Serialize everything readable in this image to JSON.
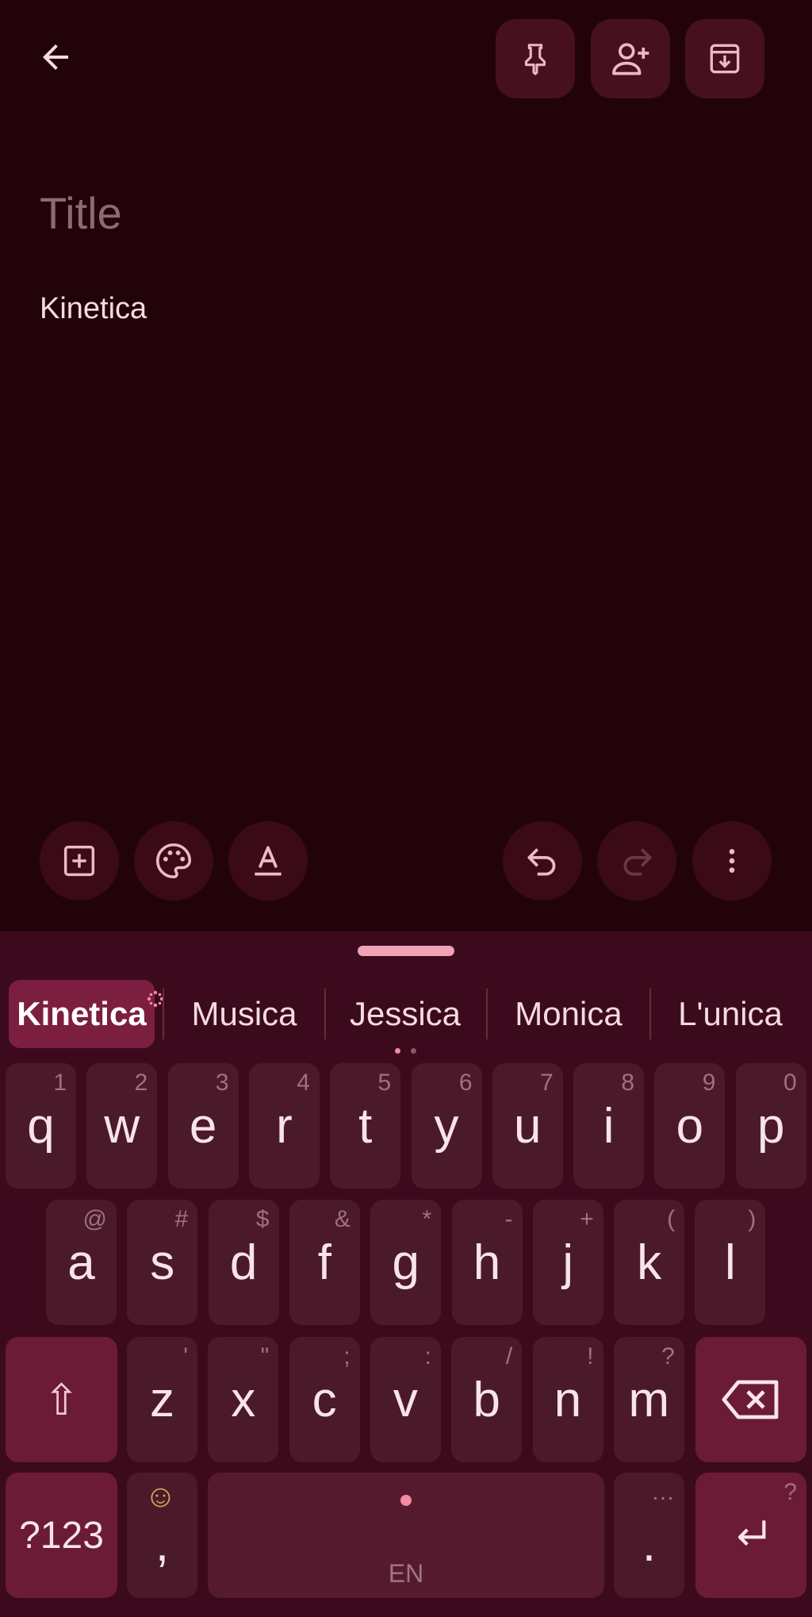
{
  "app": {
    "title_placeholder": "Title",
    "body_text": "Kinetica"
  },
  "top_bar": {
    "back": "arrow-left-icon",
    "pin": "pin-icon",
    "collaborator": "person-add-icon",
    "archive": "archive-icon"
  },
  "toolbar": {
    "add": "add-box-icon",
    "palette": "palette-icon",
    "text_format": "text-format-icon",
    "undo": "undo-icon",
    "redo": "redo-icon",
    "more": "more-vert-icon"
  },
  "suggestions": [
    {
      "label": "Kinetica",
      "active": true
    },
    {
      "label": "Musica",
      "active": false
    },
    {
      "label": "Jessica",
      "active": false
    },
    {
      "label": "Monica",
      "active": false
    },
    {
      "label": "L'unica",
      "active": false
    }
  ],
  "keyboard": {
    "row1": [
      {
        "k": "q",
        "h": "1"
      },
      {
        "k": "w",
        "h": "2"
      },
      {
        "k": "e",
        "h": "3"
      },
      {
        "k": "r",
        "h": "4"
      },
      {
        "k": "t",
        "h": "5"
      },
      {
        "k": "y",
        "h": "6"
      },
      {
        "k": "u",
        "h": "7"
      },
      {
        "k": "i",
        "h": "8"
      },
      {
        "k": "o",
        "h": "9"
      },
      {
        "k": "p",
        "h": "0"
      }
    ],
    "row2": [
      {
        "k": "a",
        "h": "@"
      },
      {
        "k": "s",
        "h": "#"
      },
      {
        "k": "d",
        "h": "$"
      },
      {
        "k": "f",
        "h": "&"
      },
      {
        "k": "g",
        "h": "*"
      },
      {
        "k": "h",
        "h": "-"
      },
      {
        "k": "j",
        "h": "+"
      },
      {
        "k": "k",
        "h": "("
      },
      {
        "k": "l",
        "h": ")"
      }
    ],
    "row3": [
      {
        "k": "z",
        "h": "'"
      },
      {
        "k": "x",
        "h": "\""
      },
      {
        "k": "c",
        "h": ";"
      },
      {
        "k": "v",
        "h": ":"
      },
      {
        "k": "b",
        "h": "/"
      },
      {
        "k": "n",
        "h": "!"
      },
      {
        "k": "m",
        "h": "?"
      }
    ],
    "shift": "⇧",
    "symbols": "?123",
    "comma": ",",
    "emoji": "☺",
    "space_label": "EN",
    "period": ".",
    "period_hint": "…",
    "enter_hint": "?"
  },
  "colors": {
    "background": "#23030b",
    "keyboard_bg": "#3c0a1d",
    "key_bg": "#4a1a2a",
    "accent": "#f0a3b6"
  }
}
